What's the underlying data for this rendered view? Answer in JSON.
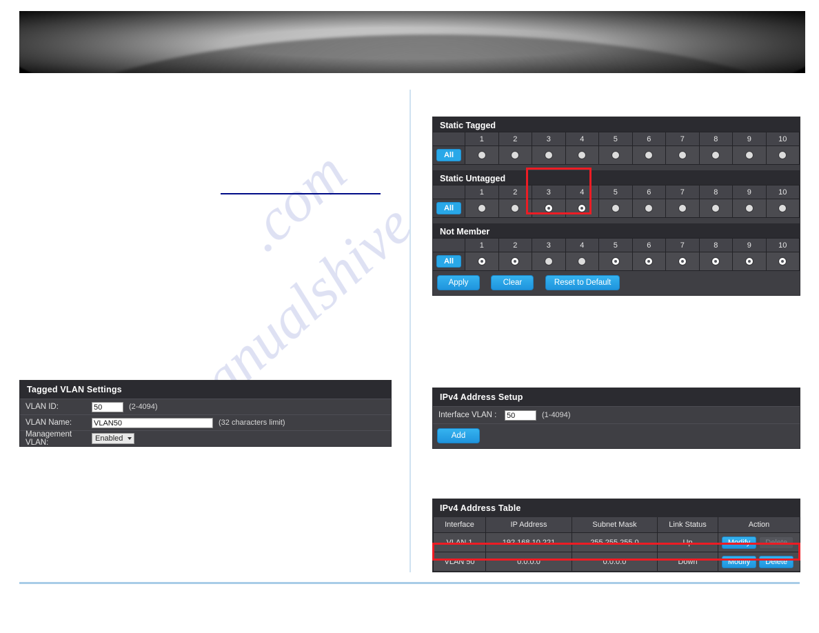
{
  "banner": {
    "name": "product-banner"
  },
  "port_membership": {
    "port_numbers": [
      "1",
      "2",
      "3",
      "4",
      "5",
      "6",
      "7",
      "8",
      "9",
      "10"
    ],
    "all_label": "All",
    "groups": [
      {
        "title": "Static Tagged",
        "states": [
          "off",
          "off",
          "off",
          "off",
          "off",
          "off",
          "off",
          "off",
          "off",
          "off"
        ]
      },
      {
        "title": "Static Untagged",
        "states": [
          "off",
          "off",
          "on",
          "on",
          "off",
          "off",
          "off",
          "off",
          "off",
          "off"
        ]
      },
      {
        "title": "Not Member",
        "states": [
          "on",
          "on",
          "off",
          "off",
          "on",
          "on",
          "on",
          "on",
          "on",
          "on"
        ]
      }
    ],
    "buttons": {
      "apply": "Apply",
      "clear": "Clear",
      "reset": "Reset to Default"
    }
  },
  "tagged_vlan_settings": {
    "title": "Tagged VLAN Settings",
    "rows": [
      {
        "label": "VLAN ID:",
        "value": "50",
        "hint": "(2-4094)"
      },
      {
        "label": "VLAN Name:",
        "value": "VLAN50",
        "hint": "(32 characters limit)"
      },
      {
        "label": "Management VLAN:",
        "value": "Enabled",
        "hint": ""
      }
    ]
  },
  "ipv4_address_setup": {
    "title": "IPv4 Address Setup",
    "interface_vlan_label": "Interface VLAN :",
    "interface_vlan_value": "50",
    "interface_vlan_hint": "(1-4094)",
    "add_label": "Add"
  },
  "ipv4_address_table": {
    "title": "IPv4 Address Table",
    "columns": [
      "Interface",
      "IP Address",
      "Subnet Mask",
      "Link Status",
      "Action"
    ],
    "rows": [
      {
        "interface": "VLAN 1",
        "ip_address": "192.168.10.221",
        "subnet_mask": "255.255.255.0",
        "link_status": "Up",
        "modify_label": "Modify",
        "delete_label": "Delete",
        "delete_enabled": false
      },
      {
        "interface": "VLAN 50",
        "ip_address": "0.0.0.0",
        "subnet_mask": "0.0.0.0",
        "link_status": "Down",
        "modify_label": "Modify",
        "delete_label": "Delete",
        "delete_enabled": true
      }
    ]
  },
  "watermark": {
    "line1": "manualshive",
    "line2": ".com"
  },
  "colors": {
    "accent_blue": "#29a8e8",
    "panel_bg": "#3f3f44",
    "panel_header": "#2b2b30",
    "highlight_red": "#ed1c24",
    "rule_blue": "#a8cce7",
    "link_blue": "#000b87"
  }
}
